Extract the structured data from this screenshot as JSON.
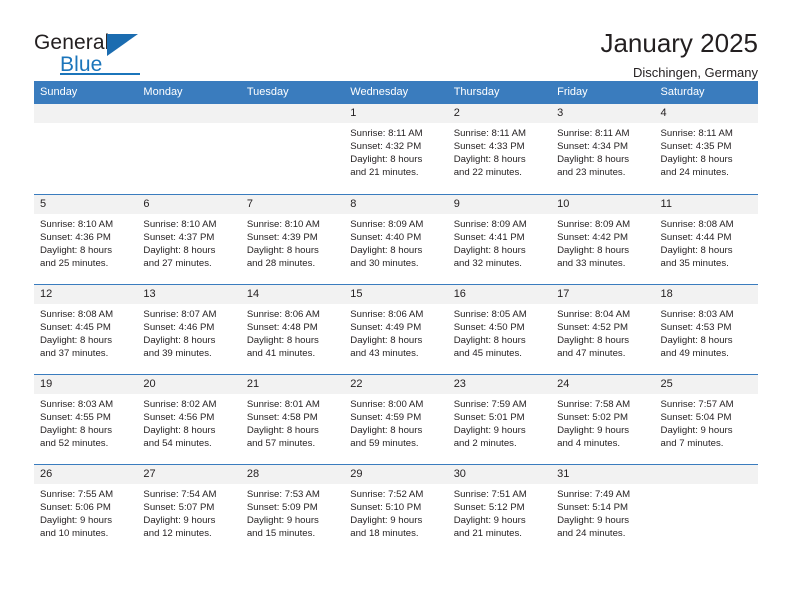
{
  "brand": {
    "name_part1": "General",
    "name_part2": "Blue",
    "logo_icon": "blue-triangle-logo"
  },
  "header": {
    "title": "January 2025",
    "subtitle": "Dischingen, Germany"
  },
  "colors": {
    "header_blue": "#3a7cbe",
    "brand_blue": "#1b75bb",
    "daynum_background": "#f2f2f2",
    "text": "#231f20"
  },
  "weekdays": [
    "Sunday",
    "Monday",
    "Tuesday",
    "Wednesday",
    "Thursday",
    "Friday",
    "Saturday"
  ],
  "labels": {
    "sunrise_prefix": "Sunrise:",
    "sunset_prefix": "Sunset:",
    "daylight_prefix": "Daylight:"
  },
  "weeks": [
    [
      {
        "empty": true
      },
      {
        "empty": true
      },
      {
        "empty": true
      },
      {
        "day": "1",
        "sunrise": "Sunrise: 8:11 AM",
        "sunset": "Sunset: 4:32 PM",
        "daylight1": "Daylight: 8 hours",
        "daylight2": "and 21 minutes."
      },
      {
        "day": "2",
        "sunrise": "Sunrise: 8:11 AM",
        "sunset": "Sunset: 4:33 PM",
        "daylight1": "Daylight: 8 hours",
        "daylight2": "and 22 minutes."
      },
      {
        "day": "3",
        "sunrise": "Sunrise: 8:11 AM",
        "sunset": "Sunset: 4:34 PM",
        "daylight1": "Daylight: 8 hours",
        "daylight2": "and 23 minutes."
      },
      {
        "day": "4",
        "sunrise": "Sunrise: 8:11 AM",
        "sunset": "Sunset: 4:35 PM",
        "daylight1": "Daylight: 8 hours",
        "daylight2": "and 24 minutes."
      }
    ],
    [
      {
        "day": "5",
        "sunrise": "Sunrise: 8:10 AM",
        "sunset": "Sunset: 4:36 PM",
        "daylight1": "Daylight: 8 hours",
        "daylight2": "and 25 minutes."
      },
      {
        "day": "6",
        "sunrise": "Sunrise: 8:10 AM",
        "sunset": "Sunset: 4:37 PM",
        "daylight1": "Daylight: 8 hours",
        "daylight2": "and 27 minutes."
      },
      {
        "day": "7",
        "sunrise": "Sunrise: 8:10 AM",
        "sunset": "Sunset: 4:39 PM",
        "daylight1": "Daylight: 8 hours",
        "daylight2": "and 28 minutes."
      },
      {
        "day": "8",
        "sunrise": "Sunrise: 8:09 AM",
        "sunset": "Sunset: 4:40 PM",
        "daylight1": "Daylight: 8 hours",
        "daylight2": "and 30 minutes."
      },
      {
        "day": "9",
        "sunrise": "Sunrise: 8:09 AM",
        "sunset": "Sunset: 4:41 PM",
        "daylight1": "Daylight: 8 hours",
        "daylight2": "and 32 minutes."
      },
      {
        "day": "10",
        "sunrise": "Sunrise: 8:09 AM",
        "sunset": "Sunset: 4:42 PM",
        "daylight1": "Daylight: 8 hours",
        "daylight2": "and 33 minutes."
      },
      {
        "day": "11",
        "sunrise": "Sunrise: 8:08 AM",
        "sunset": "Sunset: 4:44 PM",
        "daylight1": "Daylight: 8 hours",
        "daylight2": "and 35 minutes."
      }
    ],
    [
      {
        "day": "12",
        "sunrise": "Sunrise: 8:08 AM",
        "sunset": "Sunset: 4:45 PM",
        "daylight1": "Daylight: 8 hours",
        "daylight2": "and 37 minutes."
      },
      {
        "day": "13",
        "sunrise": "Sunrise: 8:07 AM",
        "sunset": "Sunset: 4:46 PM",
        "daylight1": "Daylight: 8 hours",
        "daylight2": "and 39 minutes."
      },
      {
        "day": "14",
        "sunrise": "Sunrise: 8:06 AM",
        "sunset": "Sunset: 4:48 PM",
        "daylight1": "Daylight: 8 hours",
        "daylight2": "and 41 minutes."
      },
      {
        "day": "15",
        "sunrise": "Sunrise: 8:06 AM",
        "sunset": "Sunset: 4:49 PM",
        "daylight1": "Daylight: 8 hours",
        "daylight2": "and 43 minutes."
      },
      {
        "day": "16",
        "sunrise": "Sunrise: 8:05 AM",
        "sunset": "Sunset: 4:50 PM",
        "daylight1": "Daylight: 8 hours",
        "daylight2": "and 45 minutes."
      },
      {
        "day": "17",
        "sunrise": "Sunrise: 8:04 AM",
        "sunset": "Sunset: 4:52 PM",
        "daylight1": "Daylight: 8 hours",
        "daylight2": "and 47 minutes."
      },
      {
        "day": "18",
        "sunrise": "Sunrise: 8:03 AM",
        "sunset": "Sunset: 4:53 PM",
        "daylight1": "Daylight: 8 hours",
        "daylight2": "and 49 minutes."
      }
    ],
    [
      {
        "day": "19",
        "sunrise": "Sunrise: 8:03 AM",
        "sunset": "Sunset: 4:55 PM",
        "daylight1": "Daylight: 8 hours",
        "daylight2": "and 52 minutes."
      },
      {
        "day": "20",
        "sunrise": "Sunrise: 8:02 AM",
        "sunset": "Sunset: 4:56 PM",
        "daylight1": "Daylight: 8 hours",
        "daylight2": "and 54 minutes."
      },
      {
        "day": "21",
        "sunrise": "Sunrise: 8:01 AM",
        "sunset": "Sunset: 4:58 PM",
        "daylight1": "Daylight: 8 hours",
        "daylight2": "and 57 minutes."
      },
      {
        "day": "22",
        "sunrise": "Sunrise: 8:00 AM",
        "sunset": "Sunset: 4:59 PM",
        "daylight1": "Daylight: 8 hours",
        "daylight2": "and 59 minutes."
      },
      {
        "day": "23",
        "sunrise": "Sunrise: 7:59 AM",
        "sunset": "Sunset: 5:01 PM",
        "daylight1": "Daylight: 9 hours",
        "daylight2": "and 2 minutes."
      },
      {
        "day": "24",
        "sunrise": "Sunrise: 7:58 AM",
        "sunset": "Sunset: 5:02 PM",
        "daylight1": "Daylight: 9 hours",
        "daylight2": "and 4 minutes."
      },
      {
        "day": "25",
        "sunrise": "Sunrise: 7:57 AM",
        "sunset": "Sunset: 5:04 PM",
        "daylight1": "Daylight: 9 hours",
        "daylight2": "and 7 minutes."
      }
    ],
    [
      {
        "day": "26",
        "sunrise": "Sunrise: 7:55 AM",
        "sunset": "Sunset: 5:06 PM",
        "daylight1": "Daylight: 9 hours",
        "daylight2": "and 10 minutes."
      },
      {
        "day": "27",
        "sunrise": "Sunrise: 7:54 AM",
        "sunset": "Sunset: 5:07 PM",
        "daylight1": "Daylight: 9 hours",
        "daylight2": "and 12 minutes."
      },
      {
        "day": "28",
        "sunrise": "Sunrise: 7:53 AM",
        "sunset": "Sunset: 5:09 PM",
        "daylight1": "Daylight: 9 hours",
        "daylight2": "and 15 minutes."
      },
      {
        "day": "29",
        "sunrise": "Sunrise: 7:52 AM",
        "sunset": "Sunset: 5:10 PM",
        "daylight1": "Daylight: 9 hours",
        "daylight2": "and 18 minutes."
      },
      {
        "day": "30",
        "sunrise": "Sunrise: 7:51 AM",
        "sunset": "Sunset: 5:12 PM",
        "daylight1": "Daylight: 9 hours",
        "daylight2": "and 21 minutes."
      },
      {
        "day": "31",
        "sunrise": "Sunrise: 7:49 AM",
        "sunset": "Sunset: 5:14 PM",
        "daylight1": "Daylight: 9 hours",
        "daylight2": "and 24 minutes."
      },
      {
        "empty": true
      }
    ]
  ]
}
